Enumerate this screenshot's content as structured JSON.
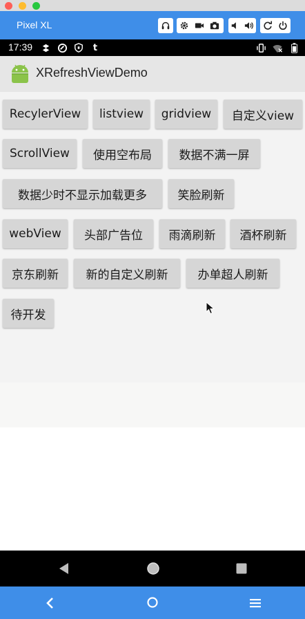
{
  "window": {
    "traffic_lights": {
      "close": "#fe5f57",
      "minimize": "#febc2e",
      "zoom": "#28c840"
    }
  },
  "emulator": {
    "device_name": "Pixel XL",
    "toolbar_icons": [
      "headphone-icon",
      "settings-icon",
      "video-icon",
      "camera-icon",
      "volume-down-icon",
      "volume-up-icon",
      "rotate-icon",
      "power-icon"
    ],
    "bottom_icons": [
      "back-chevron-icon",
      "home-circle-icon",
      "menu-icon"
    ]
  },
  "status_bar": {
    "time": "17:39",
    "tumblr_glyph": "t"
  },
  "app": {
    "title": "XRefreshViewDemo"
  },
  "buttons": [
    {
      "label": "RecylerView"
    },
    {
      "label": "listview"
    },
    {
      "label": "gridview"
    },
    {
      "label": "自定义view"
    },
    {
      "label": "ScrollView"
    },
    {
      "label": "使用空布局"
    },
    {
      "label": "数据不满一屏"
    },
    {
      "label": "数据少时不显示加载更多"
    },
    {
      "label": "笑脸刷新"
    },
    {
      "label": "webView"
    },
    {
      "label": "头部广告位"
    },
    {
      "label": "雨滴刷新"
    },
    {
      "label": "酒杯刷新"
    },
    {
      "label": "京东刷新"
    },
    {
      "label": "新的自定义刷新"
    },
    {
      "label": "办单超人刷新"
    },
    {
      "label": "待开发"
    }
  ],
  "colors": {
    "emulator_blue": "#3f8ee8",
    "app_bar": "#e6e6e6",
    "button_bg": "#d6d6d6",
    "android_green": "#8bc34a"
  }
}
